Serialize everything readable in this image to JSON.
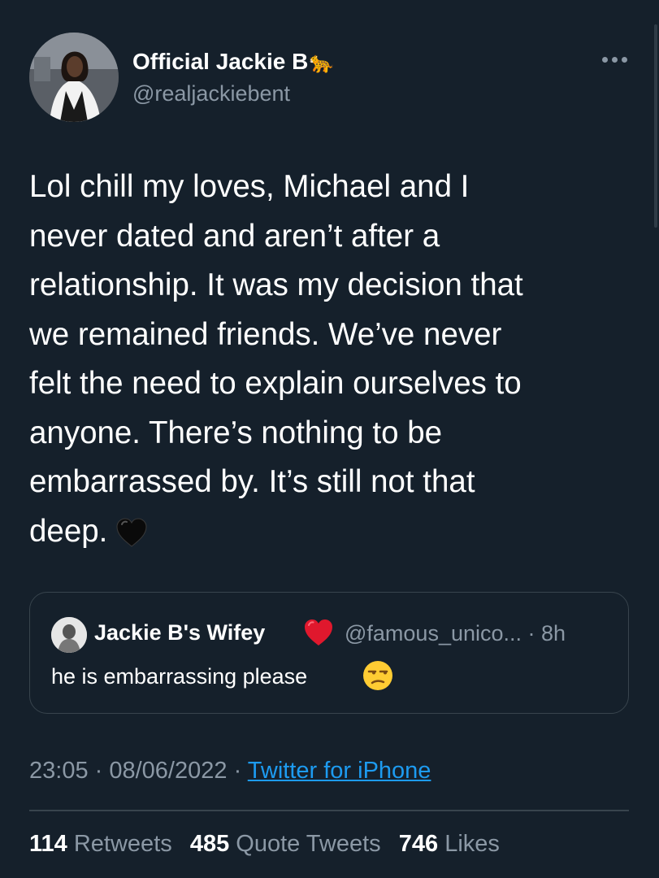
{
  "author": {
    "display_name": "Official Jackie B",
    "name_emoji": "🐆",
    "handle": "@realjackiebent"
  },
  "tweet": {
    "text": "Lol chill my loves, Michael and I\nnever dated and aren’t after a\nrelationship. It was my decision that\nwe remained friends. We’ve never\nfelt the need to explain ourselves to\nanyone. There’s nothing to be\nembarrassed by. It’s still not that\ndeep.",
    "trailing_emoji": "🖤"
  },
  "quote": {
    "display_name": "Jackie B's Wifey",
    "name_emoji": "❤️",
    "handle_time": "@famous_unico... · 8h",
    "text": "he is embarrassing please",
    "text_emoji": "😒"
  },
  "meta": {
    "time": "23:05",
    "separator": " · ",
    "date": "08/06/2022",
    "source": "Twitter for iPhone"
  },
  "stats": {
    "retweets_count": "114",
    "retweets_label": "Retweets",
    "quotes_count": "485",
    "quotes_label": "Quote Tweets",
    "likes_count": "746",
    "likes_label": "Likes"
  },
  "colors": {
    "background": "#15202b",
    "secondary_text": "#8b98a5",
    "link": "#1d9bf0",
    "border": "#38444d"
  }
}
